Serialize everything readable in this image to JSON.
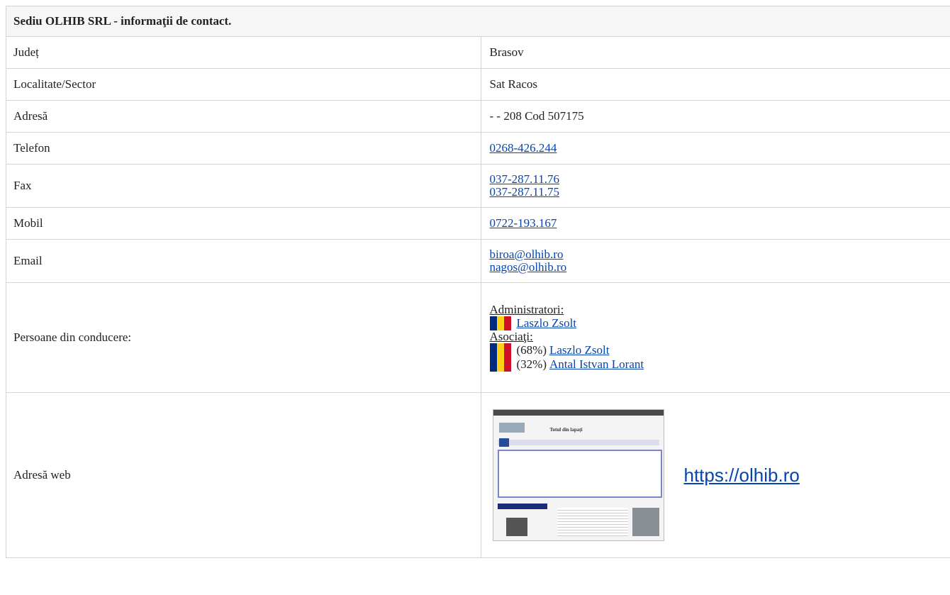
{
  "title": "Sediu OLHIB SRL - informaţii de contact.",
  "rows": {
    "judet": {
      "label": "Județ",
      "value": "Brasov"
    },
    "localitate": {
      "label": "Localitate/Sector",
      "value": "Sat Racos"
    },
    "adresa": {
      "label": "Adresă",
      "value": "- - 208 Cod 507175"
    },
    "telefon": {
      "label": "Telefon",
      "value": "0268-426.244"
    },
    "fax": {
      "label": "Fax",
      "values": [
        "037-287.11.76",
        "037-287.11.75"
      ]
    },
    "mobil": {
      "label": "Mobil",
      "value": "0722-193.167"
    },
    "email": {
      "label": "Email",
      "values": [
        "biroa@olhib.ro",
        "nagos@olhib.ro"
      ]
    },
    "persoane": {
      "label": "Persoane din conducere:",
      "admin_heading": "Administratori:",
      "admins": [
        {
          "name": "Laszlo Zsolt"
        }
      ],
      "assoc_heading": "Asociaţi:",
      "associates": [
        {
          "pct": "(68%)",
          "name": "Laszlo Zsolt"
        },
        {
          "pct": "(32%)",
          "name": "Antal Istvan Lorant"
        }
      ],
      "flag_icon": "romania-flag-icon",
      "flag_colors": [
        "#002b7f",
        "#fcd116",
        "#ce1126"
      ]
    },
    "web": {
      "label": "Adresă web",
      "url": "https://olhib.ro",
      "thumb_heading": "Totul din lapați"
    }
  },
  "colors": {
    "link": "#0645ad",
    "border": "#d4d4d4",
    "title_bg": "#f6f6f6"
  }
}
